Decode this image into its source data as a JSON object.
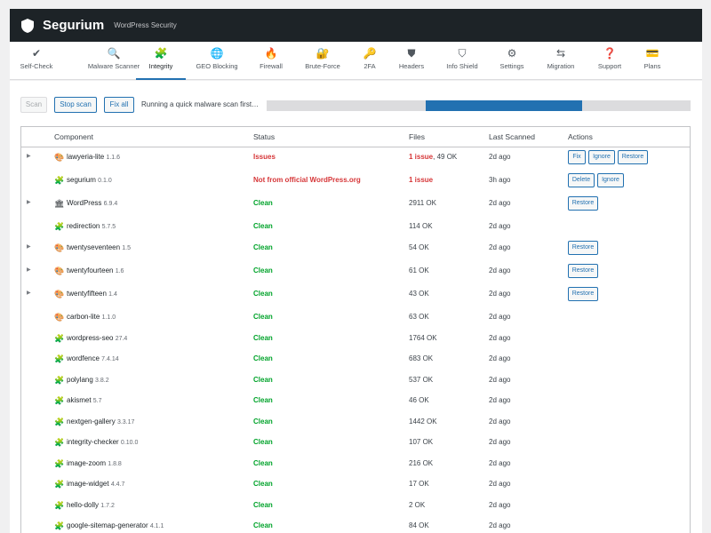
{
  "header": {
    "brand": "Segurium",
    "subtitle": "WordPress Security",
    "icon": "shield-icon"
  },
  "tabs": [
    {
      "label": "Self-Check",
      "icon": "check-circle-icon",
      "active": false
    },
    {
      "label": "Malware Scanner",
      "icon": "magnifier-icon",
      "active": false
    },
    {
      "label": "Integrity",
      "icon": "puzzle-icon",
      "active": true
    },
    {
      "label": "GEO Blocking",
      "icon": "globe-icon",
      "active": false
    },
    {
      "label": "Firewall",
      "icon": "flame-icon",
      "active": false
    },
    {
      "label": "Brute-Force",
      "icon": "lock-icon",
      "active": false
    },
    {
      "label": "2FA",
      "icon": "key-icon",
      "active": false
    },
    {
      "label": "Headers",
      "icon": "shield-icon",
      "active": false
    },
    {
      "label": "Info Shield",
      "icon": "shield-info-icon",
      "active": false
    },
    {
      "label": "Settings",
      "icon": "gear-icon",
      "active": false
    },
    {
      "label": "Migration",
      "icon": "swap-arrows-icon",
      "active": false
    },
    {
      "label": "Support",
      "icon": "question-icon",
      "active": false
    },
    {
      "label": "Plans",
      "icon": "credit-card-icon",
      "active": false
    }
  ],
  "toolbar": {
    "scan_label": "Scan",
    "stop_label": "Stop scan",
    "fixall_label": "Fix all",
    "scan_message": "Running a quick malware scan first…",
    "progress_start": 0.375,
    "progress_end": 0.745
  },
  "table": {
    "headers": {
      "component": "Component",
      "status": "Status",
      "files": "Files",
      "last_scanned": "Last Scanned",
      "actions": "Actions"
    },
    "rows": [
      {
        "name": "lawyeria-lite",
        "version": "1.1.6",
        "type": "theme",
        "expandable": true,
        "status": "Issues",
        "status_kind": "bad",
        "files_bad": "1 issue",
        "files_ok": ", 49 OK",
        "scanned": "2d ago",
        "actions": [
          "Fix",
          "Ignore",
          "Restore"
        ]
      },
      {
        "name": "segurium",
        "version": "0.1.0",
        "type": "plugin",
        "expandable": false,
        "status": "Not from official WordPress.org",
        "status_kind": "bad",
        "files_bad": "1 issue",
        "files_ok": "",
        "scanned": "3h ago",
        "actions": [
          "Delete",
          "Ignore"
        ]
      },
      {
        "name": "WordPress",
        "version": "6.9.4",
        "type": "core",
        "expandable": true,
        "status": "Clean",
        "status_kind": "clean",
        "files_bad": "",
        "files_ok": "2911 OK",
        "scanned": "2d ago",
        "actions": [
          "Restore"
        ]
      },
      {
        "name": "redirection",
        "version": "5.7.5",
        "type": "plugin",
        "expandable": false,
        "status": "Clean",
        "status_kind": "clean",
        "files_bad": "",
        "files_ok": "114 OK",
        "scanned": "2d ago",
        "actions": []
      },
      {
        "name": "twentyseventeen",
        "version": "1.5",
        "type": "theme",
        "expandable": true,
        "status": "Clean",
        "status_kind": "clean",
        "files_bad": "",
        "files_ok": "54 OK",
        "scanned": "2d ago",
        "actions": [
          "Restore"
        ]
      },
      {
        "name": "twentyfourteen",
        "version": "1.6",
        "type": "theme",
        "expandable": true,
        "status": "Clean",
        "status_kind": "clean",
        "files_bad": "",
        "files_ok": "61 OK",
        "scanned": "2d ago",
        "actions": [
          "Restore"
        ]
      },
      {
        "name": "twentyfifteen",
        "version": "1.4",
        "type": "theme",
        "expandable": true,
        "status": "Clean",
        "status_kind": "clean",
        "files_bad": "",
        "files_ok": "43 OK",
        "scanned": "2d ago",
        "actions": [
          "Restore"
        ]
      },
      {
        "name": "carbon-lite",
        "version": "1.1.0",
        "type": "theme",
        "expandable": false,
        "status": "Clean",
        "status_kind": "clean",
        "files_bad": "",
        "files_ok": "63 OK",
        "scanned": "2d ago",
        "actions": []
      },
      {
        "name": "wordpress-seo",
        "version": "27.4",
        "type": "plugin",
        "expandable": false,
        "status": "Clean",
        "status_kind": "clean",
        "files_bad": "",
        "files_ok": "1764 OK",
        "scanned": "2d ago",
        "actions": []
      },
      {
        "name": "wordfence",
        "version": "7.4.14",
        "type": "plugin",
        "expandable": false,
        "status": "Clean",
        "status_kind": "clean",
        "files_bad": "",
        "files_ok": "683 OK",
        "scanned": "2d ago",
        "actions": []
      },
      {
        "name": "polylang",
        "version": "3.8.2",
        "type": "plugin",
        "expandable": false,
        "status": "Clean",
        "status_kind": "clean",
        "files_bad": "",
        "files_ok": "537 OK",
        "scanned": "2d ago",
        "actions": []
      },
      {
        "name": "akismet",
        "version": "5.7",
        "type": "plugin",
        "expandable": false,
        "status": "Clean",
        "status_kind": "clean",
        "files_bad": "",
        "files_ok": "46 OK",
        "scanned": "2d ago",
        "actions": []
      },
      {
        "name": "nextgen-gallery",
        "version": "3.3.17",
        "type": "plugin",
        "expandable": false,
        "status": "Clean",
        "status_kind": "clean",
        "files_bad": "",
        "files_ok": "1442 OK",
        "scanned": "2d ago",
        "actions": []
      },
      {
        "name": "integrity-checker",
        "version": "0.10.0",
        "type": "plugin",
        "expandable": false,
        "status": "Clean",
        "status_kind": "clean",
        "files_bad": "",
        "files_ok": "107 OK",
        "scanned": "2d ago",
        "actions": []
      },
      {
        "name": "image-zoom",
        "version": "1.8.8",
        "type": "plugin",
        "expandable": false,
        "status": "Clean",
        "status_kind": "clean",
        "files_bad": "",
        "files_ok": "216 OK",
        "scanned": "2d ago",
        "actions": []
      },
      {
        "name": "image-widget",
        "version": "4.4.7",
        "type": "plugin",
        "expandable": false,
        "status": "Clean",
        "status_kind": "clean",
        "files_bad": "",
        "files_ok": "17 OK",
        "scanned": "2d ago",
        "actions": []
      },
      {
        "name": "hello-dolly",
        "version": "1.7.2",
        "type": "plugin",
        "expandable": false,
        "status": "Clean",
        "status_kind": "clean",
        "files_bad": "",
        "files_ok": "2 OK",
        "scanned": "2d ago",
        "actions": []
      },
      {
        "name": "google-sitemap-generator",
        "version": "4.1.1",
        "type": "plugin",
        "expandable": false,
        "status": "Clean",
        "status_kind": "clean",
        "files_bad": "",
        "files_ok": "84 OK",
        "scanned": "2d ago",
        "actions": []
      }
    ]
  },
  "colors": {
    "accent": "#2271b1",
    "clean": "#00a32a",
    "error": "#d63638",
    "topbar": "#1d2327"
  }
}
